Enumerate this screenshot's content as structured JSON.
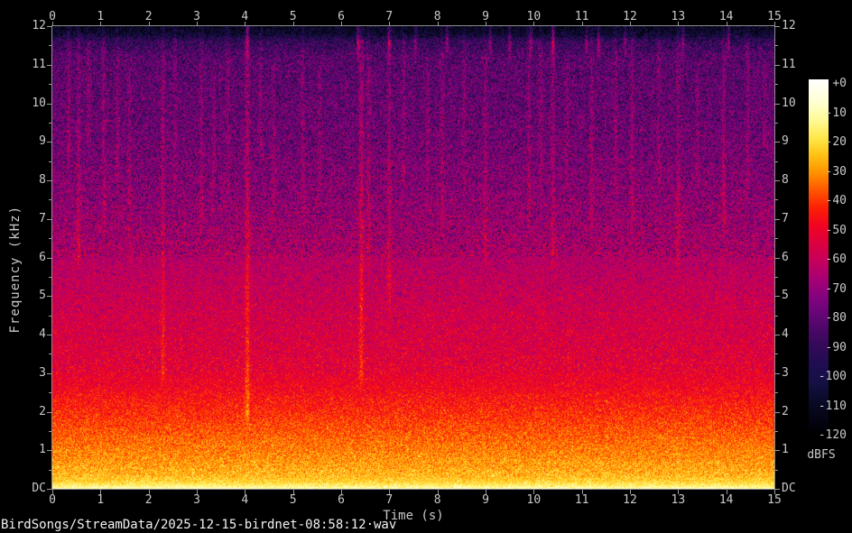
{
  "window": {
    "filename": "BirdSongs/StreamData/2025-12-15-birdnet-08:58:12·wav"
  },
  "colors": {
    "background": "#000000",
    "axis_line": "#8c8c8c",
    "tick_label": "#c9c9c9",
    "filename_text": "#f2f2f2"
  },
  "chart_data": {
    "type": "heatmap",
    "subtype": "audio-spectrogram",
    "xlabel": "Time (s)",
    "ylabel": "Frequency (kHz)",
    "x_range_s": [
      0,
      15
    ],
    "y_range_khz": [
      0,
      12
    ],
    "x_ticks": [
      "0",
      "1",
      "2",
      "3",
      "4",
      "5",
      "6",
      "7",
      "8",
      "9",
      "10",
      "11",
      "12",
      "13",
      "14",
      "15"
    ],
    "y_ticks": [
      "12",
      "11",
      "10",
      "9",
      "8",
      "7",
      "6",
      "5",
      "4",
      "3",
      "2",
      "1",
      "DC"
    ],
    "x_minor_tick_step": null,
    "y_minor_tick_step": 0.5,
    "colorbar": {
      "label": "dBFS",
      "ticks": [
        "+0",
        "-10",
        "-20",
        "-30",
        "-40",
        "-50",
        "-60",
        "-70",
        "-80",
        "-90",
        "-100",
        "-110",
        "-120"
      ],
      "range_db": [
        0,
        -120
      ],
      "stops": [
        [
          0,
          [
            255,
            255,
            255
          ]
        ],
        [
          -8,
          [
            255,
            255,
            208
          ]
        ],
        [
          -14,
          [
            255,
            250,
            148
          ]
        ],
        [
          -20,
          [
            255,
            230,
            72
          ]
        ],
        [
          -26,
          [
            255,
            192,
            20
          ]
        ],
        [
          -32,
          [
            255,
            144,
            0
          ]
        ],
        [
          -38,
          [
            255,
            84,
            0
          ]
        ],
        [
          -44,
          [
            252,
            30,
            6
          ]
        ],
        [
          -50,
          [
            240,
            4,
            34
          ]
        ],
        [
          -56,
          [
            220,
            0,
            64
          ]
        ],
        [
          -62,
          [
            198,
            0,
            92
          ]
        ],
        [
          -68,
          [
            168,
            0,
            116
          ]
        ],
        [
          -74,
          [
            134,
            2,
            126
          ]
        ],
        [
          -80,
          [
            102,
            6,
            118
          ]
        ],
        [
          -86,
          [
            72,
            8,
            102
          ]
        ],
        [
          -92,
          [
            48,
            10,
            88
          ]
        ],
        [
          -98,
          [
            30,
            14,
            80
          ]
        ],
        [
          -104,
          [
            20,
            16,
            66
          ]
        ],
        [
          -110,
          [
            10,
            10,
            40
          ]
        ],
        [
          -115,
          [
            5,
            5,
            22
          ]
        ],
        [
          -120,
          [
            1,
            1,
            8
          ]
        ]
      ]
    },
    "noise_floor_profile_khz_db": [
      [
        12.0,
        -113
      ],
      [
        11.8,
        -106
      ],
      [
        11.6,
        -90
      ],
      [
        11.2,
        -82
      ],
      [
        10.5,
        -80
      ],
      [
        9.5,
        -78
      ],
      [
        8.5,
        -75
      ],
      [
        7.5,
        -71
      ],
      [
        6.5,
        -67
      ],
      [
        5.5,
        -62
      ],
      [
        4.5,
        -58
      ],
      [
        3.5,
        -55
      ],
      [
        3.0,
        -53
      ],
      [
        2.6,
        -50
      ],
      [
        2.2,
        -46
      ],
      [
        1.8,
        -42
      ],
      [
        1.4,
        -38
      ],
      [
        1.0,
        -34
      ],
      [
        0.7,
        -31
      ],
      [
        0.4,
        -28
      ],
      [
        0.2,
        -24
      ],
      [
        0.08,
        -17
      ],
      [
        0.0,
        -10
      ]
    ],
    "broadband_events": [
      {
        "t": 0.34,
        "f_lo": 8.5,
        "f_hi": 12,
        "amp": 8
      },
      {
        "t": 0.55,
        "f_lo": 6,
        "f_hi": 12,
        "amp": 9
      },
      {
        "t": 0.75,
        "f_lo": 9,
        "f_hi": 12,
        "amp": 7
      },
      {
        "t": 1.07,
        "f_lo": 7,
        "f_hi": 12,
        "amp": 8
      },
      {
        "t": 1.35,
        "f_lo": 8,
        "f_hi": 12,
        "amp": 7
      },
      {
        "t": 1.6,
        "f_lo": 6,
        "f_hi": 11,
        "amp": 6
      },
      {
        "t": 2.3,
        "f_lo": 3,
        "f_hi": 12,
        "amp": 9
      },
      {
        "t": 2.55,
        "f_lo": 8,
        "f_hi": 12,
        "amp": 7
      },
      {
        "t": 3.1,
        "f_lo": 7,
        "f_hi": 12,
        "amp": 7
      },
      {
        "t": 3.35,
        "f_lo": 8,
        "f_hi": 11,
        "amp": 6
      },
      {
        "t": 3.65,
        "f_lo": 8,
        "f_hi": 12,
        "amp": 7
      },
      {
        "t": 4.05,
        "f_lo": 2,
        "f_hi": 12,
        "amp": 12
      },
      {
        "t": 4.33,
        "f_lo": 9,
        "f_hi": 12,
        "amp": 7
      },
      {
        "t": 4.6,
        "f_lo": 7,
        "f_hi": 11,
        "amp": 6
      },
      {
        "t": 5.2,
        "f_lo": 8,
        "f_hi": 12,
        "amp": 7
      },
      {
        "t": 5.55,
        "f_lo": 8,
        "f_hi": 11,
        "amp": 6
      },
      {
        "t": 6.42,
        "f_lo": 3,
        "f_hi": 12,
        "amp": 12
      },
      {
        "t": 6.57,
        "f_lo": 6,
        "f_hi": 12,
        "amp": 9
      },
      {
        "t": 7.0,
        "f_lo": 5,
        "f_hi": 12,
        "amp": 9
      },
      {
        "t": 7.3,
        "f_lo": 8,
        "f_hi": 12,
        "amp": 7
      },
      {
        "t": 7.8,
        "f_lo": 8,
        "f_hi": 11,
        "amp": 6
      },
      {
        "t": 8.1,
        "f_lo": 7,
        "f_hi": 12,
        "amp": 8
      },
      {
        "t": 8.55,
        "f_lo": 8,
        "f_hi": 12,
        "amp": 7
      },
      {
        "t": 9.0,
        "f_lo": 6,
        "f_hi": 12,
        "amp": 8
      },
      {
        "t": 9.9,
        "f_lo": 7,
        "f_hi": 12,
        "amp": 8
      },
      {
        "t": 10.15,
        "f_lo": 8,
        "f_hi": 12,
        "amp": 7
      },
      {
        "t": 10.4,
        "f_lo": 6,
        "f_hi": 12,
        "amp": 8
      },
      {
        "t": 10.7,
        "f_lo": 8,
        "f_hi": 11,
        "amp": 6
      },
      {
        "t": 11.2,
        "f_lo": 7,
        "f_hi": 12,
        "amp": 8
      },
      {
        "t": 11.7,
        "f_lo": 8,
        "f_hi": 12,
        "amp": 7
      },
      {
        "t": 12.05,
        "f_lo": 7,
        "f_hi": 12,
        "amp": 8
      },
      {
        "t": 12.6,
        "f_lo": 8,
        "f_hi": 12,
        "amp": 7
      },
      {
        "t": 13.0,
        "f_lo": 6,
        "f_hi": 12,
        "amp": 8
      },
      {
        "t": 13.4,
        "f_lo": 8,
        "f_hi": 11,
        "amp": 6
      },
      {
        "t": 13.95,
        "f_lo": 7,
        "f_hi": 12,
        "amp": 9
      },
      {
        "t": 14.45,
        "f_lo": 8,
        "f_hi": 12,
        "amp": 8
      },
      {
        "t": 14.8,
        "f_lo": 9,
        "f_hi": 11,
        "amp": 6
      }
    ],
    "top_spike_band": {
      "f_lo": 11.55,
      "f_hi": 12.05
    },
    "top_spikes": [
      {
        "t": 4.05,
        "amp": 24
      },
      {
        "t": 6.35,
        "amp": 26
      },
      {
        "t": 7.0,
        "amp": 22
      },
      {
        "t": 7.55,
        "amp": 20
      },
      {
        "t": 8.2,
        "amp": 22
      },
      {
        "t": 9.1,
        "amp": 20
      },
      {
        "t": 9.5,
        "amp": 24
      },
      {
        "t": 9.95,
        "amp": 22
      },
      {
        "t": 10.4,
        "amp": 26
      },
      {
        "t": 11.1,
        "amp": 20
      },
      {
        "t": 11.35,
        "amp": 24
      },
      {
        "t": 11.9,
        "amp": 20
      },
      {
        "t": 13.1,
        "amp": 22
      },
      {
        "t": 14.05,
        "amp": 22
      }
    ]
  }
}
